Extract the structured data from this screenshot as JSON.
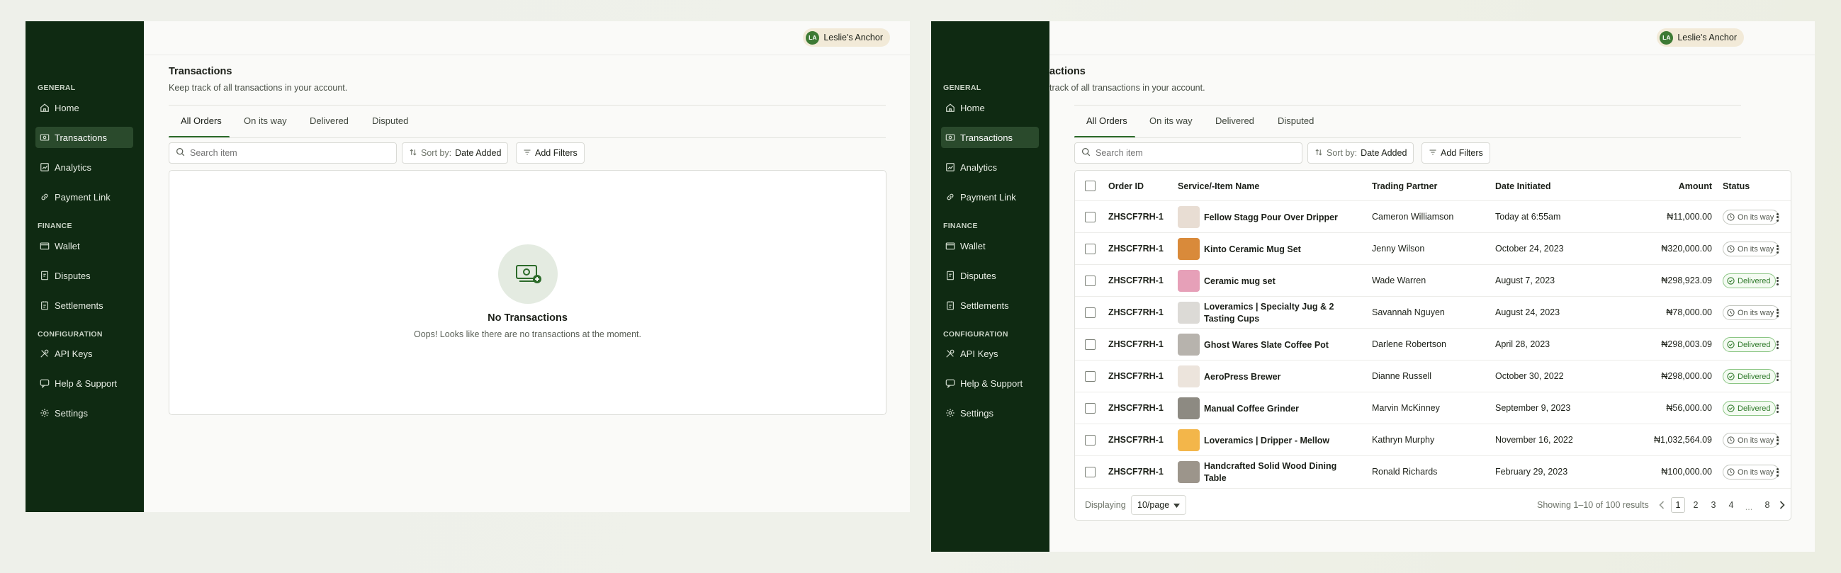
{
  "user": {
    "initials": "LA",
    "name": "Leslie's Anchor"
  },
  "sidebar": {
    "sections": [
      "GENERAL",
      "FINANCE",
      "CONFIGURATION"
    ],
    "items": [
      {
        "label": "Home",
        "icon": "home-icon"
      },
      {
        "label": "Transactions",
        "icon": "transactions-icon"
      },
      {
        "label": "Analytics",
        "icon": "analytics-icon"
      },
      {
        "label": "Payment Link",
        "icon": "link-icon"
      },
      {
        "label": "Wallet",
        "icon": "wallet-icon"
      },
      {
        "label": "Disputes",
        "icon": "disputes-icon"
      },
      {
        "label": "Settlements",
        "icon": "settlements-icon"
      },
      {
        "label": "API Keys",
        "icon": "api-keys-icon"
      },
      {
        "label": "Help & Support",
        "icon": "support-icon"
      },
      {
        "label": "Settings",
        "icon": "gear-icon"
      }
    ],
    "active": "Transactions"
  },
  "page": {
    "title": "Transactions",
    "title_right_visible": "actions",
    "subtitle": "Keep track of all transactions in your account.",
    "subtitle_right_visible": "track of all transactions in your account."
  },
  "tabs": [
    "All Orders",
    "On its way",
    "Delivered",
    "Disputed"
  ],
  "active_tab": "All Orders",
  "toolbar": {
    "search_placeholder": "Search item",
    "sort_prefix": "Sort by:",
    "sort_value": "Date Added",
    "filters_label": "Add Filters"
  },
  "empty_state": {
    "title": "No Transactions",
    "message": "Oops! Looks like there are no transactions at the moment."
  },
  "table": {
    "columns": [
      "Order ID",
      "Service/-Item Name",
      "Trading Partner",
      "Date Initiated",
      "Amount",
      "Status"
    ],
    "rows": [
      {
        "order_id": "ZHSCF7RH-1",
        "item": "Fellow Stagg Pour Over Dripper",
        "partner": "Cameron Williamson",
        "date": "Today at 6:55am",
        "amount": "₦11,000.00",
        "status": "On its way",
        "thumb": "#e8ddd3"
      },
      {
        "order_id": "ZHSCF7RH-1",
        "item": "Kinto Ceramic Mug Set",
        "partner": "Jenny Wilson",
        "date": "October 24, 2023",
        "amount": "₦320,000.00",
        "status": "On its way",
        "thumb": "#d98a3a"
      },
      {
        "order_id": "ZHSCF7RH-1",
        "item": "Ceramic mug set",
        "partner": "Wade Warren",
        "date": "August 7, 2023",
        "amount": "₦298,923.09",
        "status": "Delivered",
        "thumb": "#e6a0b8"
      },
      {
        "order_id": "ZHSCF7RH-1",
        "item": "Loveramics | Specialty Jug & 2 Tasting Cups",
        "partner": "Savannah Nguyen",
        "date": "August 24, 2023",
        "amount": "₦78,000.00",
        "status": "On its way",
        "thumb": "#dcdad6"
      },
      {
        "order_id": "ZHSCF7RH-1",
        "item": "Ghost Wares Slate Coffee Pot",
        "partner": "Darlene Robertson",
        "date": "April 28, 2023",
        "amount": "₦298,003.09",
        "status": "Delivered",
        "thumb": "#b7b3ad"
      },
      {
        "order_id": "ZHSCF7RH-1",
        "item": "AeroPress Brewer",
        "partner": "Dianne Russell",
        "date": "October 30, 2022",
        "amount": "₦298,000.00",
        "status": "Delivered",
        "thumb": "#ece4dc"
      },
      {
        "order_id": "ZHSCF7RH-1",
        "item": "Manual Coffee Grinder",
        "partner": "Marvin McKinney",
        "date": "September 9, 2023",
        "amount": "₦56,000.00",
        "status": "Delivered",
        "thumb": "#8d8a82"
      },
      {
        "order_id": "ZHSCF7RH-1",
        "item": "Loveramics | Dripper - Mellow",
        "partner": "Kathryn Murphy",
        "date": "November 16, 2022",
        "amount": "₦1,032,564.09",
        "status": "On its way",
        "thumb": "#f3b64a"
      },
      {
        "order_id": "ZHSCF7RH-1",
        "item": "Handcrafted Solid Wood Dining Table",
        "partner": "Ronald Richards",
        "date": "February 29, 2023",
        "amount": "₦100,000.00",
        "status": "On its way",
        "thumb": "#9c958b"
      }
    ]
  },
  "pagination": {
    "displaying_label": "Displaying",
    "per_page": "10/page",
    "summary": "Showing 1–10 of 100 results",
    "pages": [
      "1",
      "2",
      "3",
      "4",
      "...",
      "8"
    ],
    "current": "1"
  },
  "colors": {
    "sidebar_bg": "#0f2a12",
    "accent": "#2c6b2a",
    "delivered": "#2f7a2a",
    "pill_bg": "#f2ead8"
  }
}
